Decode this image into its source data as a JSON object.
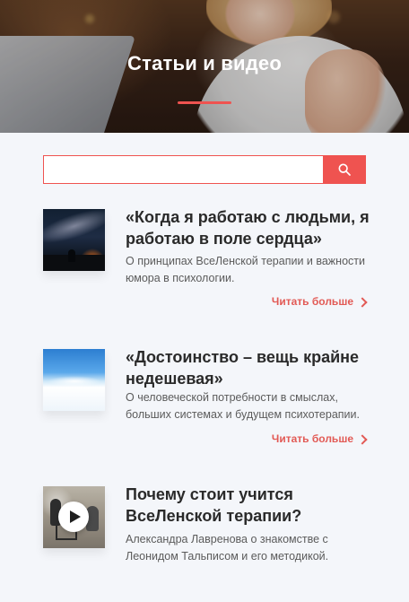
{
  "header": {
    "title": "Статьи и видео"
  },
  "search": {
    "value": "",
    "placeholder": ""
  },
  "articles": [
    {
      "title": "«Когда я работаю с людьми, я работаю в поле сердца»",
      "description": "О принципах ВсеЛенской терапии и важности юмора в психологии.",
      "read_more": "Читать больше",
      "thumbnail_icon": "night-sky-thumbnail"
    },
    {
      "title": "«Достоинство – вещь крайне недешевая»",
      "description": "О человеческой потребности в смыслах, больших системах и будущем психотерапии.",
      "read_more": "Читать больше",
      "thumbnail_icon": "sky-clouds-thumbnail"
    },
    {
      "title": "Почему стоит учится ВсеЛенской терапии?",
      "description": "Александра Лавренова о знакомстве с Леонидом Тальписом и его методикой.",
      "thumbnail_icon": "video-thumbnail"
    }
  ],
  "colors": {
    "accent": "#ef5350",
    "background": "#f4f6fa",
    "text": "#2b2b2b",
    "muted_text": "#5b5b5b"
  }
}
